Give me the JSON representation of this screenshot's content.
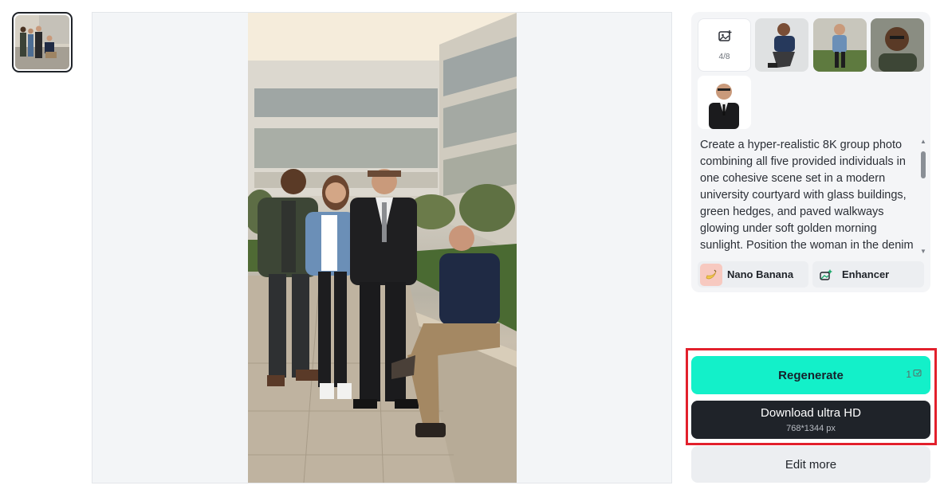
{
  "references": {
    "upload_count": "4/8",
    "items": [
      "ref-man-blue-shirt-sitting",
      "ref-woman-denim-jacket",
      "ref-man-glasses-green-jacket",
      "ref-man-suit-glasses"
    ]
  },
  "prompt": {
    "text": "Create a hyper-realistic 8K group photo combining all five provided individuals in one cohesive scene set in a modern university courtyard with glass buildings, green hedges, and paved walkways glowing under soft golden morning sunlight. Position the woman in the denim jacket at the front left"
  },
  "chips": {
    "model_label": "Nano Banana",
    "enhancer_label": "Enhancer"
  },
  "actions": {
    "regenerate_label": "Regenerate",
    "regenerate_cost": "1",
    "download_label": "Download ultra HD",
    "download_size": "768*1344 px",
    "edit_label": "Edit more"
  },
  "colors": {
    "accent": "#13f0c9",
    "dark_button": "#1f2329",
    "highlight": "#e2202c"
  }
}
